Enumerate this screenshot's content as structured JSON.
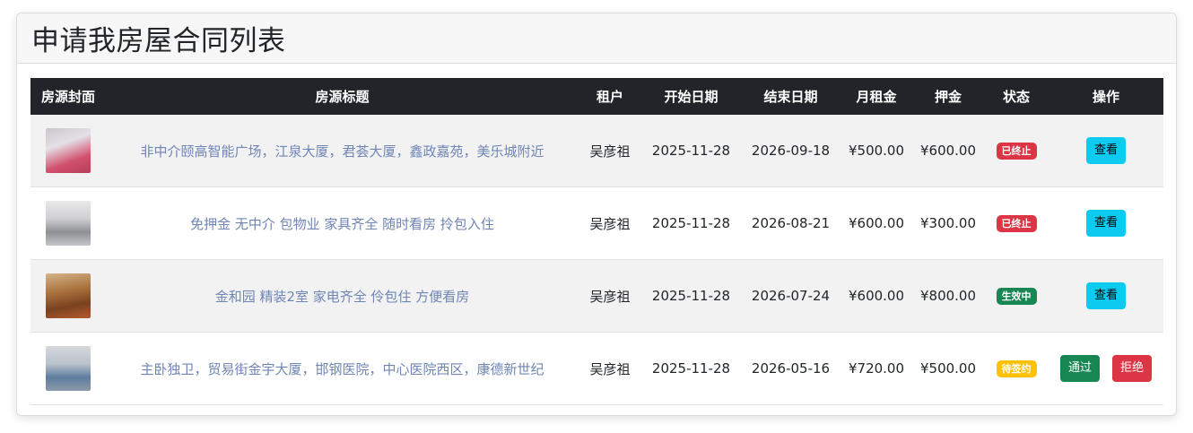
{
  "page": {
    "title": "申请我房屋合同列表"
  },
  "table": {
    "headers": {
      "cover": "房源封面",
      "title": "房源标题",
      "tenant": "租户",
      "start": "开始日期",
      "end": "结束日期",
      "rent": "月租金",
      "deposit": "押金",
      "status": "状态",
      "action": "操作"
    },
    "rows": [
      {
        "title": "非中介颐高智能广场，江泉大厦，君荟大厦，鑫政嘉苑，美乐城附近",
        "tenant": "吴彦祖",
        "start": "2025-11-28",
        "end": "2026-09-18",
        "rent": "¥500.00",
        "deposit": "¥600.00",
        "status": "已终止",
        "action_view": "查看"
      },
      {
        "title": "免押金 无中介 包物业 家具齐全 随时看房 拎包入住",
        "tenant": "吴彦祖",
        "start": "2025-11-28",
        "end": "2026-08-21",
        "rent": "¥600.00",
        "deposit": "¥300.00",
        "status": "已终止",
        "action_view": "查看"
      },
      {
        "title": "金和园 精装2室 家电齐全 伶包住 方便看房",
        "tenant": "吴彦祖",
        "start": "2025-11-28",
        "end": "2026-07-24",
        "rent": "¥600.00",
        "deposit": "¥800.00",
        "status": "生效中",
        "action_view": "查看"
      },
      {
        "title": "主卧独卫，贸易街金宇大厦，邯钢医院，中心医院西区，康德新世纪",
        "tenant": "吴彦祖",
        "start": "2025-11-28",
        "end": "2026-05-16",
        "rent": "¥720.00",
        "deposit": "¥500.00",
        "status": "待签约",
        "action_approve": "通过",
        "action_reject": "拒绝"
      }
    ]
  },
  "colors": {
    "header_bg": "#212529",
    "link": "#6f85b6",
    "danger": "#dc3545",
    "success": "#198754",
    "warning": "#ffc107",
    "info": "#0dcaf0"
  }
}
